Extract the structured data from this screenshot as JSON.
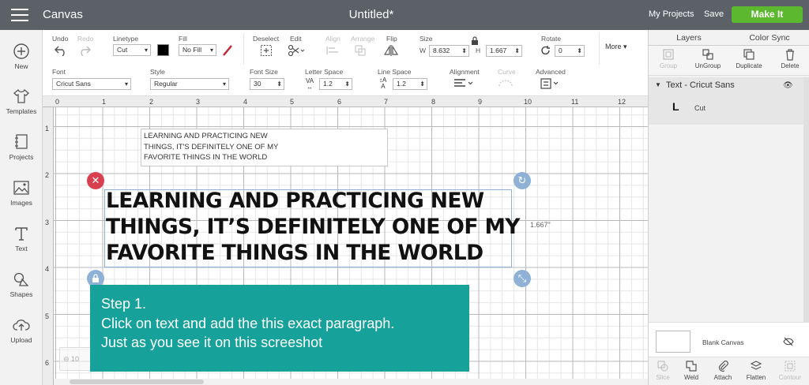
{
  "header": {
    "app_title": "Canvas",
    "doc_title": "Untitled*",
    "my_projects": "My Projects",
    "save": "Save",
    "make_it": "Make It"
  },
  "left_nav": [
    {
      "label": "New",
      "icon": "plus-circle-icon"
    },
    {
      "label": "Templates",
      "icon": "shirt-icon"
    },
    {
      "label": "Projects",
      "icon": "projects-icon"
    },
    {
      "label": "Images",
      "icon": "image-icon"
    },
    {
      "label": "Text",
      "icon": "text-icon"
    },
    {
      "label": "Shapes",
      "icon": "shapes-icon"
    },
    {
      "label": "Upload",
      "icon": "upload-cloud-icon"
    }
  ],
  "toolbar": {
    "undo": "Undo",
    "redo": "Redo",
    "linetype_label": "Linetype",
    "linetype_value": "Cut",
    "fill_label": "Fill",
    "fill_value": "No Fill",
    "deselect": "Deselect",
    "edit": "Edit",
    "align": "Align",
    "arrange": "Arrange",
    "flip": "Flip",
    "size_label": "Size",
    "w_label": "W",
    "w_value": "8.632",
    "h_label": "H",
    "h_value": "1.667",
    "rotate_label": "Rotate",
    "rotate_value": "0",
    "more": "More",
    "font_label": "Font",
    "font_value": "Cricut Sans",
    "style_label": "Style",
    "style_value": "Regular",
    "font_size_label": "Font Size",
    "font_size_value": "30",
    "letter_space_label": "Letter Space",
    "letter_space_value": "1.2",
    "line_space_label": "Line Space",
    "line_space_value": "1.2",
    "alignment_label": "Alignment",
    "curve_label": "Curve",
    "advanced_label": "Advanced",
    "linetype_color": "#000000",
    "fill_color": "#c0262d"
  },
  "ruler": {
    "top": [
      "0",
      "1",
      "2",
      "3",
      "4",
      "5",
      "6",
      "7",
      "8",
      "9",
      "10",
      "11",
      "12"
    ],
    "left": [
      "1",
      "2",
      "3",
      "4",
      "5",
      "6"
    ]
  },
  "canvas": {
    "editor_lines": [
      "LEARNING AND PRACTICING NEW",
      "THINGS, IT'S DEFINITELY ONE OF MY",
      "FAVORITE THINGS IN THE WORLD"
    ],
    "text_lines": [
      "LEARNING AND PRACTICING NEW",
      "THINGS, IT’S DEFINITELY ONE OF MY",
      "FAVORITE THINGS IN THE WORLD"
    ],
    "height_label": "1.667\"",
    "zoom_label": "10"
  },
  "step": {
    "line1": "Step 1.",
    "line2": "Click on text and add the this exact  paragraph.",
    "line3": "Just as you see it on this screeshot",
    "bg_color": "#16a29a"
  },
  "right_panel": {
    "tab_layers": "Layers",
    "tab_color_sync": "Color Sync",
    "tools": [
      "Group",
      "UnGroup",
      "Duplicate",
      "Delete"
    ],
    "layer_name": "Text - Cricut Sans",
    "layer_letter": "L",
    "layer_op": "Cut",
    "blank_canvas": "Blank Canvas",
    "bottom_tools": [
      "Slice",
      "Weld",
      "Attach",
      "Flatten",
      "Contour"
    ]
  }
}
